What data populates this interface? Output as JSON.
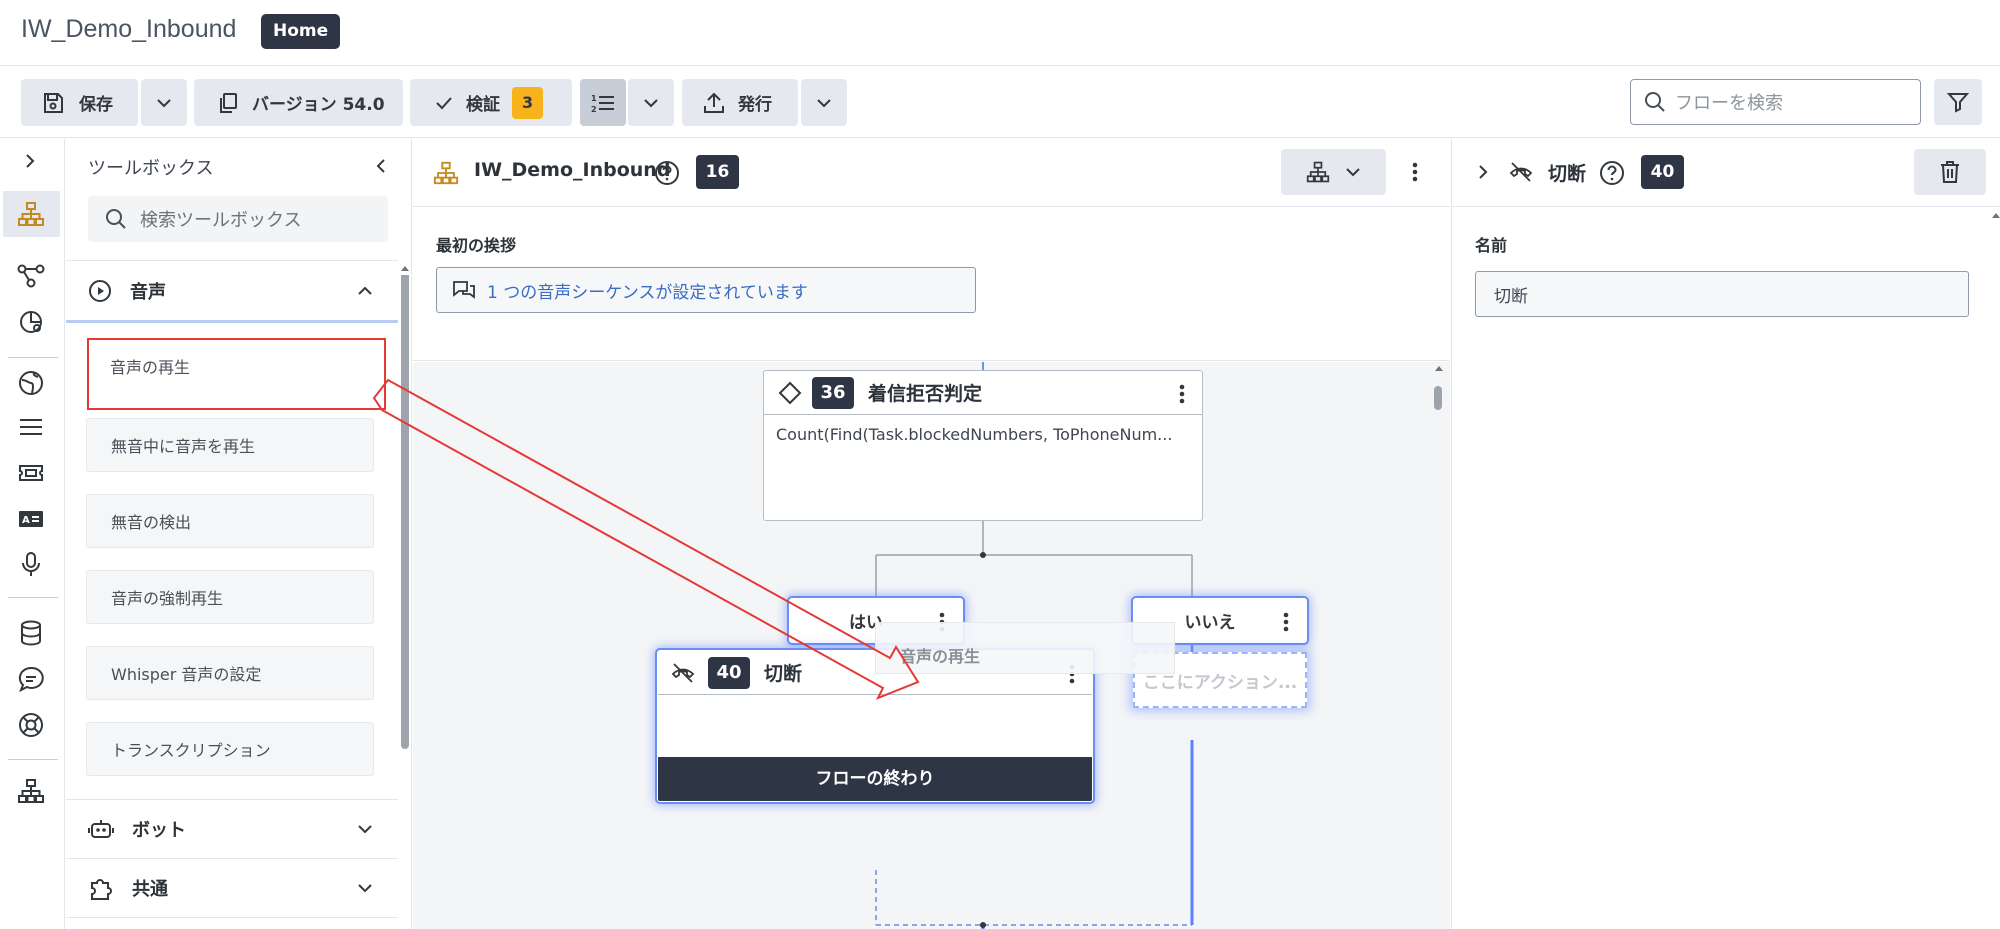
{
  "header": {
    "app_title": "IW_Demo_Inbound",
    "home_label": "Home"
  },
  "toolbar": {
    "save_label": "保存",
    "version_label": "バージョン 54.0",
    "validate_label": "検証",
    "validate_count": "3",
    "publish_label": "発行",
    "search_placeholder": "フローを検索"
  },
  "toolbox": {
    "title": "ツールボックス",
    "search_placeholder": "検索ツールボックス",
    "sections": {
      "audio": "音声",
      "bot": "ボット",
      "common": "共通"
    },
    "items": [
      "音声の再生",
      "無音中に音声を再生",
      "無音の検出",
      "音声の強制再生",
      "Whisper 音声の設定",
      "トランスクリプション"
    ]
  },
  "canvas": {
    "flow_name": "IW_Demo_Inbound",
    "flow_count": "16",
    "greeting_label": "最初の挨拶",
    "greeting_value": "1 つの音声シーケンスが設定されています",
    "decision": {
      "id": "36",
      "title": "着信拒否判定",
      "expression": "Count(Find(Task.blockedNumbers, ToPhoneNum..."
    },
    "branch_yes": "はい",
    "branch_no": "いいえ",
    "drag_ghost": "音声の再生",
    "disconnect": {
      "id": "40",
      "title": "切断",
      "footer": "フローの終わり"
    },
    "drop_placeholder": "ここにアクション..."
  },
  "right_panel": {
    "title": "切断",
    "count": "40",
    "name_label": "名前",
    "name_value": "切断"
  },
  "colors": {
    "accent_dark": "#2e3645",
    "warning": "#f7b21c",
    "highlight_red": "#e53935",
    "glow_blue": "#5a82ff",
    "link_blue": "#3a6cc2"
  }
}
